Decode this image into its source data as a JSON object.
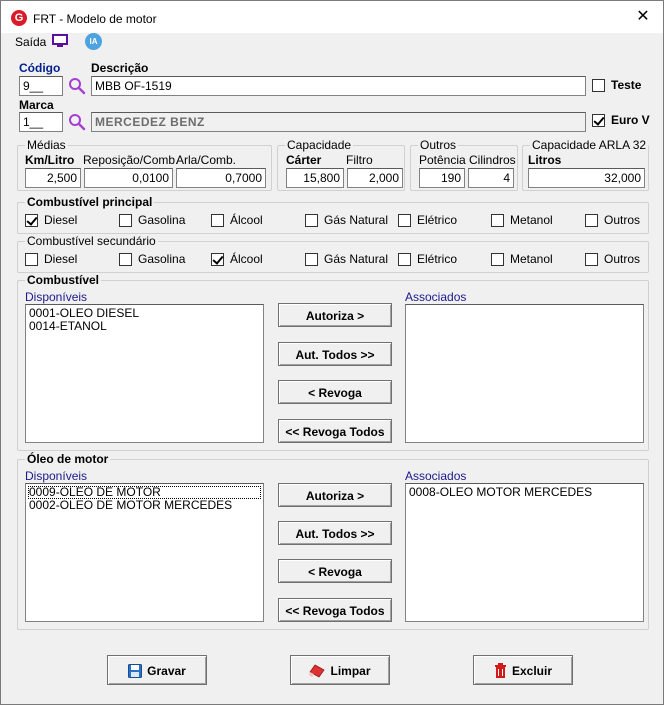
{
  "window": {
    "title": "FRT - Modelo de motor",
    "logo_letter": "G"
  },
  "menu": {
    "saida": "Saída",
    "ia": "IA"
  },
  "codigo": {
    "label": "Código",
    "value": "9__"
  },
  "descricao": {
    "label": "Descrição",
    "value": "MBB OF-1519"
  },
  "teste": {
    "label": "Teste",
    "checked": false
  },
  "marca": {
    "label": "Marca",
    "value": "1__",
    "name": "MERCEDEZ BENZ"
  },
  "eurov": {
    "label": "Euro V",
    "checked": true
  },
  "medias": {
    "title": "Médias",
    "km_label": "Km/Litro",
    "km_value": "2,500",
    "rep_label": "Reposição/Comb.",
    "rep_value": "0,0100",
    "arla_label": "Arla/Comb.",
    "arla_value": "0,7000"
  },
  "capacidade": {
    "title": "Capacidade",
    "carter_label": "Cárter",
    "carter_value": "15,800",
    "filtro_label": "Filtro",
    "filtro_value": "2,000"
  },
  "outros": {
    "title": "Outros",
    "potencia_label": "Potência",
    "potencia_value": "190",
    "cilindros_label": "Cilindros",
    "cilindros_value": "4"
  },
  "arla32": {
    "title": "Capacidade  ARLA 32",
    "litros_label": "Litros",
    "litros_value": "32,000"
  },
  "combustivel_principal": {
    "title": "Combustível principal",
    "options": [
      {
        "label": "Diesel",
        "checked": true
      },
      {
        "label": "Gasolina",
        "checked": false
      },
      {
        "label": "Álcool",
        "checked": false
      },
      {
        "label": "Gás Natural",
        "checked": false
      },
      {
        "label": "Elétrico",
        "checked": false
      },
      {
        "label": "Metanol",
        "checked": false
      },
      {
        "label": "Outros",
        "checked": false
      }
    ]
  },
  "combustivel_secundario": {
    "title": "Combustível secundário",
    "options": [
      {
        "label": "Diesel",
        "checked": false
      },
      {
        "label": "Gasolina",
        "checked": false
      },
      {
        "label": "Álcool",
        "checked": true
      },
      {
        "label": "Gás Natural",
        "checked": false
      },
      {
        "label": "Elétrico",
        "checked": false
      },
      {
        "label": "Metanol",
        "checked": false
      },
      {
        "label": "Outros",
        "checked": false
      }
    ]
  },
  "combustivel": {
    "title": "Combustível",
    "disponiveis_label": "Disponíveis",
    "associados_label": "Associados",
    "disponiveis": [
      "0001-OLEO DIESEL",
      "0014-ETANOL"
    ],
    "associados": []
  },
  "oleo": {
    "title": "Óleo de motor",
    "disponiveis_label": "Disponíveis",
    "associados_label": "Associados",
    "disponiveis": [
      "0009-OLEO DE MOTOR",
      "0002-OLEO DE MOTOR MERCEDES"
    ],
    "associados": [
      "0008-OLEO MOTOR MERCEDES"
    ]
  },
  "transfer_buttons": {
    "autoriza": "Autoriza >",
    "aut_todos": "Aut. Todos >>",
    "revoga": "< Revoga",
    "revoga_todos": "<< Revoga Todos"
  },
  "footer": {
    "gravar": "Gravar",
    "limpar": "Limpar",
    "excluir": "Excluir"
  },
  "colors": {
    "accent_blue": "#001f8c",
    "search_icon": "#a43fd0",
    "logo_red": "#d91c2a"
  }
}
